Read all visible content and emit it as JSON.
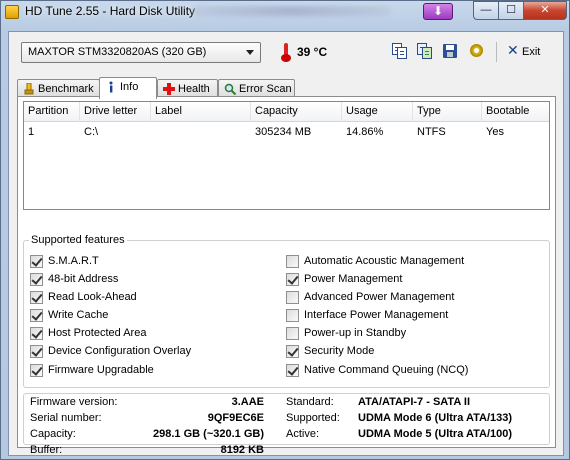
{
  "window": {
    "title": "HD Tune 2.55 - Hard Disk Utility",
    "download_glyph": "⬇",
    "minimize_glyph": "—",
    "maximize_glyph": "☐",
    "close_glyph": "✕"
  },
  "toolbar": {
    "drive": "MAXTOR STM3320820AS (320 GB)",
    "temperature": "39 °C",
    "exit_label": "Exit",
    "exit_glyph": "✕",
    "icons": [
      "copy-text-icon",
      "copy-screenshot-icon",
      "save-icon",
      "options-icon"
    ]
  },
  "tabs": [
    {
      "label": "Benchmark",
      "icon": "benchmark-icon",
      "active": false
    },
    {
      "label": "Info",
      "icon": "info-icon",
      "active": true
    },
    {
      "label": "Health",
      "icon": "health-icon",
      "active": false
    },
    {
      "label": "Error Scan",
      "icon": "magnifier-icon",
      "active": false
    }
  ],
  "partitions": {
    "columns": [
      "Partition",
      "Drive letter",
      "Label",
      "Capacity",
      "Usage",
      "Type",
      "Bootable"
    ],
    "rows": [
      [
        "1",
        "C:\\",
        "",
        "305234 MB",
        "14.86%",
        "NTFS",
        "Yes"
      ]
    ]
  },
  "features": {
    "title": "Supported features",
    "left": [
      {
        "label": "S.M.A.R.T",
        "checked": true
      },
      {
        "label": "48-bit Address",
        "checked": true
      },
      {
        "label": "Read Look-Ahead",
        "checked": true
      },
      {
        "label": "Write Cache",
        "checked": true
      },
      {
        "label": "Host Protected Area",
        "checked": true
      },
      {
        "label": "Device Configuration Overlay",
        "checked": true
      },
      {
        "label": "Firmware Upgradable",
        "checked": true
      }
    ],
    "right": [
      {
        "label": "Automatic Acoustic Management",
        "checked": false
      },
      {
        "label": "Power Management",
        "checked": true
      },
      {
        "label": "Advanced Power Management",
        "checked": false
      },
      {
        "label": "Interface Power Management",
        "checked": false
      },
      {
        "label": "Power-up in Standby",
        "checked": false
      },
      {
        "label": "Security Mode",
        "checked": true
      },
      {
        "label": "Native Command Queuing (NCQ)",
        "checked": true
      }
    ]
  },
  "info": {
    "firmware_label": "Firmware version:",
    "firmware": "3.AAE",
    "serial_label": "Serial number:",
    "serial": "9QF9EC6E",
    "capacity_label": "Capacity:",
    "capacity": "298.1 GB (~320.1 GB)",
    "buffer_label": "Buffer:",
    "buffer": "8192 KB",
    "standard_label": "Standard:",
    "standard": "ATA/ATAPI-7 - SATA II",
    "supported_label": "Supported:",
    "supported": "UDMA Mode 6 (Ultra ATA/133)",
    "active_label": "Active:",
    "active": "UDMA Mode 5 (Ultra ATA/100)"
  }
}
